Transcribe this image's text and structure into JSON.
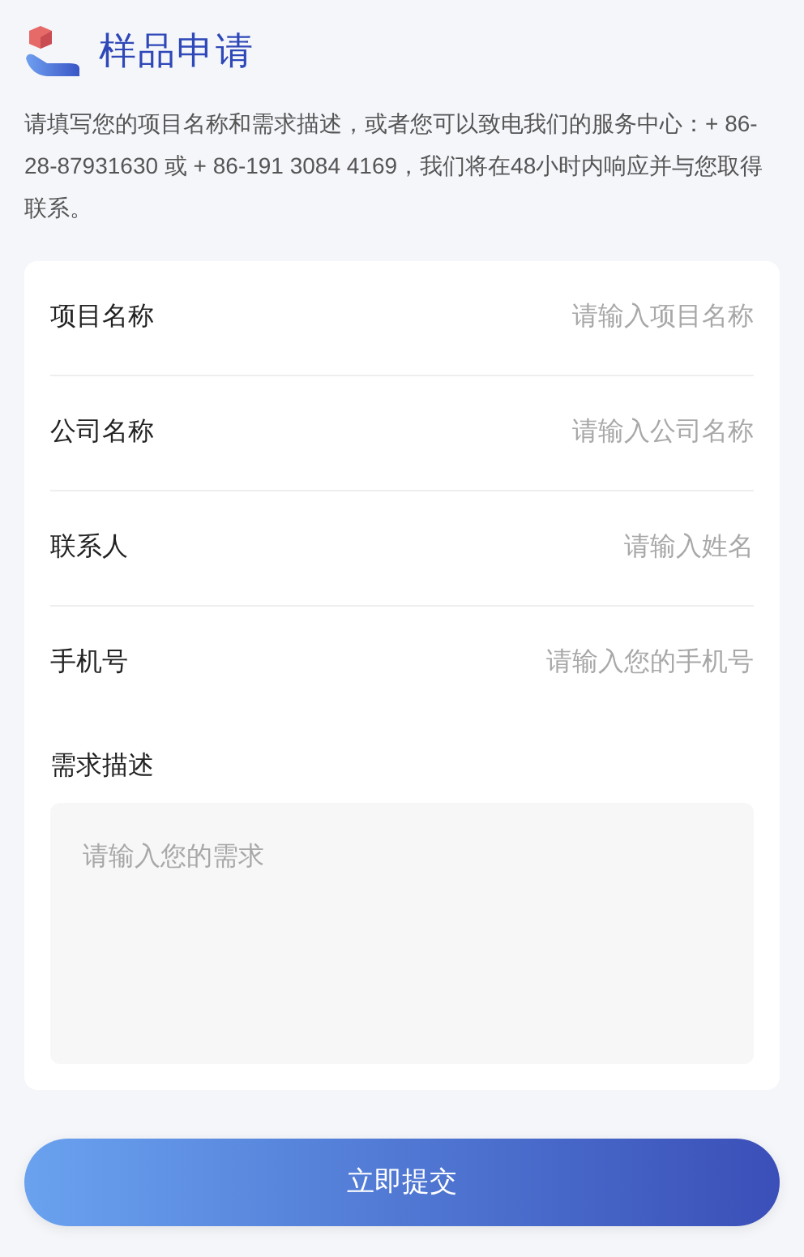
{
  "header": {
    "title": "样品申请"
  },
  "intro": "请填写您的项目名称和需求描述，或者您可以致电我们的服务中心：+ 86-28-87931630 或 + 86-191 3084 4169，我们将在48小时内响应并与您取得联系。",
  "fields": [
    {
      "kind": "input",
      "label": "项目名称",
      "placeholder": "请输入项目名称"
    },
    {
      "kind": "input",
      "label": "公司名称",
      "placeholder": "请输入公司名称"
    },
    {
      "kind": "input",
      "label": "联系人",
      "placeholder": "请输入姓名"
    },
    {
      "kind": "input",
      "label": "手机号",
      "placeholder": "请输入您的手机号"
    },
    {
      "kind": "textarea",
      "label": "需求描述",
      "placeholder": "请输入您的需求"
    }
  ],
  "submit": "立即提交"
}
